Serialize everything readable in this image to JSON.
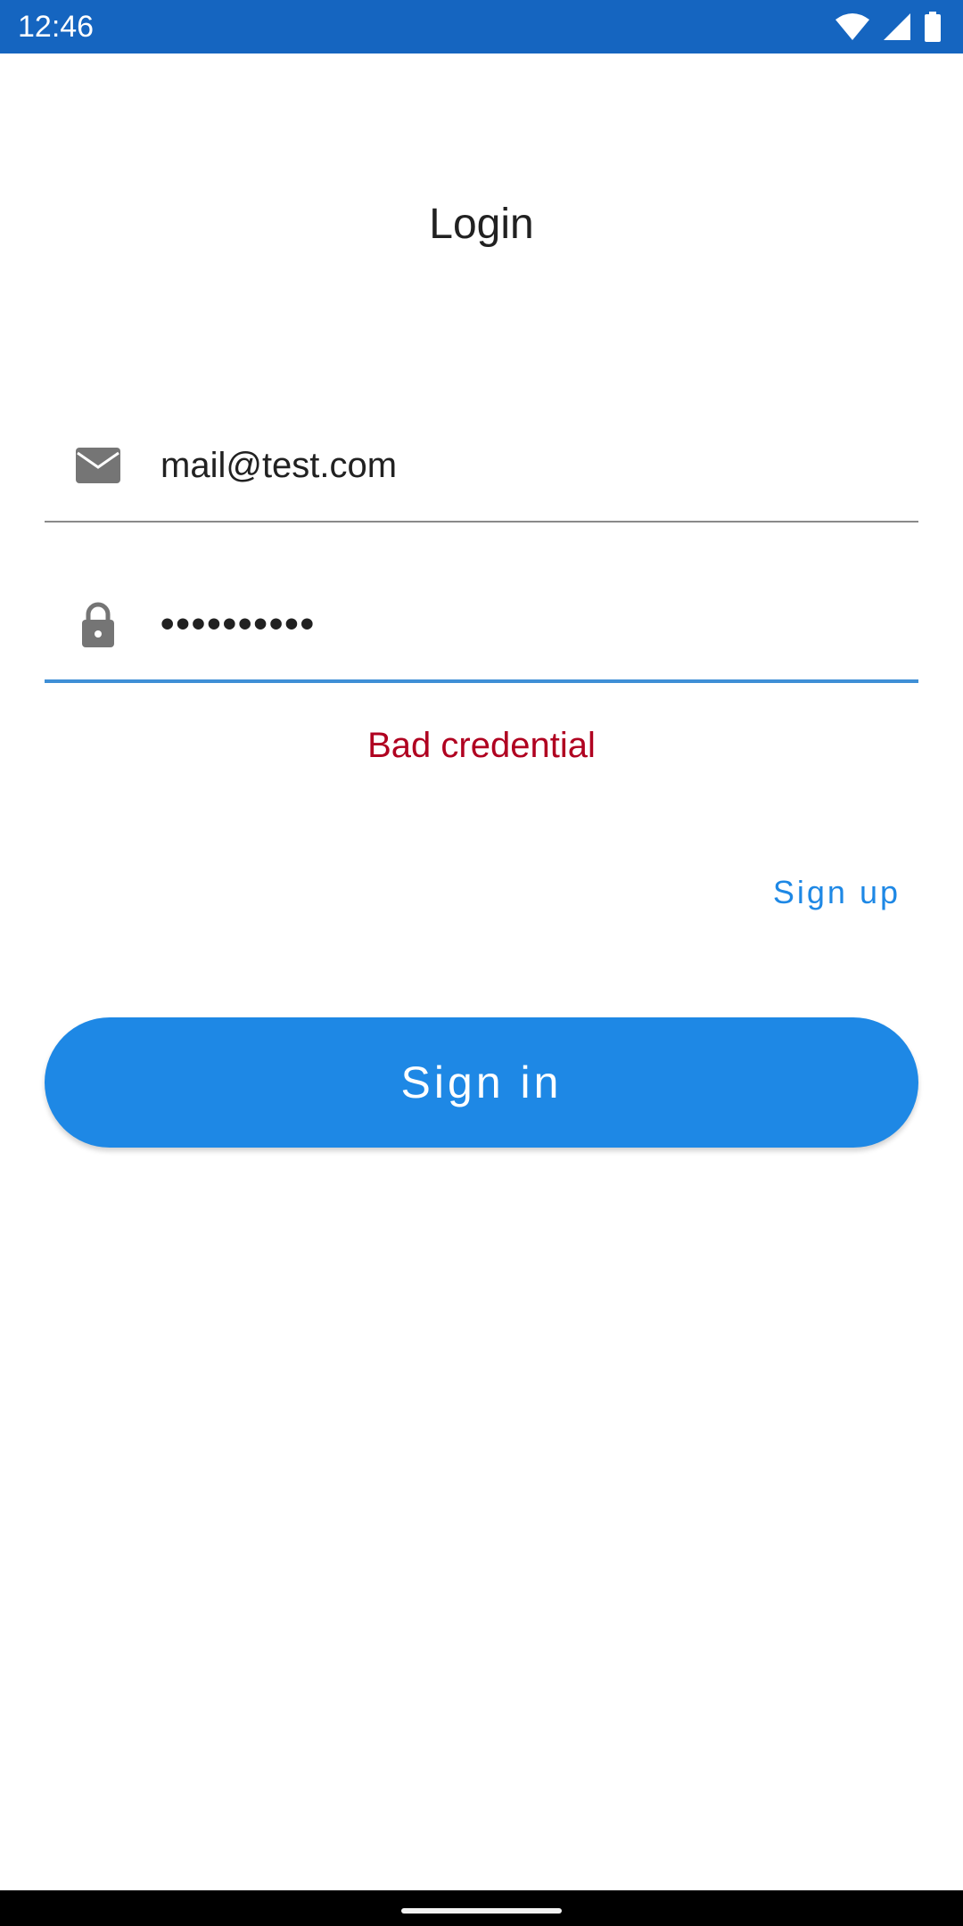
{
  "status_bar": {
    "time": "12:46",
    "icons": [
      "wifi-icon",
      "signal-icon",
      "battery-icon"
    ],
    "background": "#1565c0"
  },
  "login": {
    "title": "Login",
    "email": {
      "icon": "mail-icon",
      "value": "mail@test.com"
    },
    "password": {
      "icon": "lock-icon",
      "value": "••••••••••"
    },
    "error": "Bad credential",
    "signup_label": "Sign up",
    "signin_label": "Sign in"
  },
  "colors": {
    "accent": "#1e88e5",
    "error": "#b00020",
    "icon_gray": "#757575"
  }
}
